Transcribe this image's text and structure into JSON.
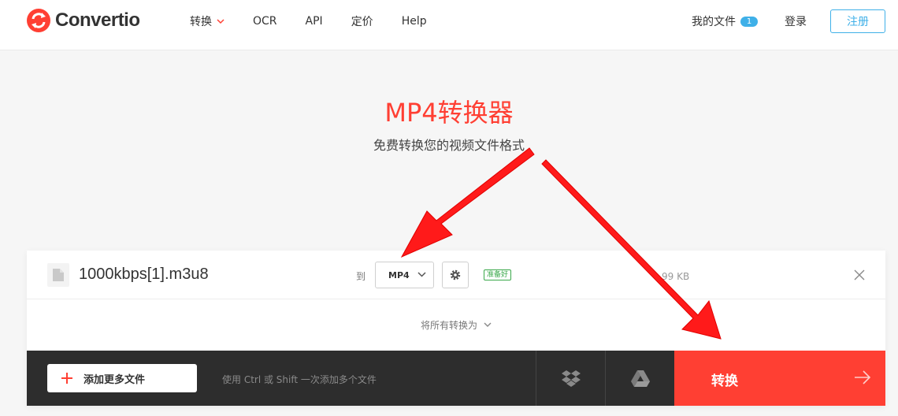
{
  "brand": {
    "name": "Convertio",
    "accent": "#ff3f33"
  },
  "nav": {
    "items": [
      {
        "label": "转换",
        "has_dropdown": true
      },
      {
        "label": "OCR"
      },
      {
        "label": "API"
      },
      {
        "label": "定价"
      },
      {
        "label": "Help"
      }
    ]
  },
  "header_right": {
    "my_files_label": "我的文件",
    "my_files_count": "1",
    "login_label": "登录",
    "register_label": "注册"
  },
  "hero": {
    "title": "MP4转换器",
    "subtitle": "免费转换您的视频文件格式"
  },
  "file": {
    "name": "1000kbps[1].m3u8",
    "to_label": "到",
    "format": "MP4",
    "status": "准备好",
    "size": "99 KB"
  },
  "convert_all_label": "将所有转换为",
  "bottom": {
    "add_more_label": "添加更多文件",
    "hint": "使用 Ctrl 或 Shift 一次添加多个文件",
    "convert_label": "转换"
  },
  "icons": {
    "file": "file-icon",
    "settings": "gear-icon",
    "close": "close-icon",
    "dropbox": "dropbox-icon",
    "gdrive": "google-drive-icon",
    "arrow": "arrow-right-icon"
  },
  "colors": {
    "accent": "#ff3f33",
    "link": "#3fb0e8",
    "ready": "#3aa84a",
    "dark_bar": "#2d2d2d"
  }
}
